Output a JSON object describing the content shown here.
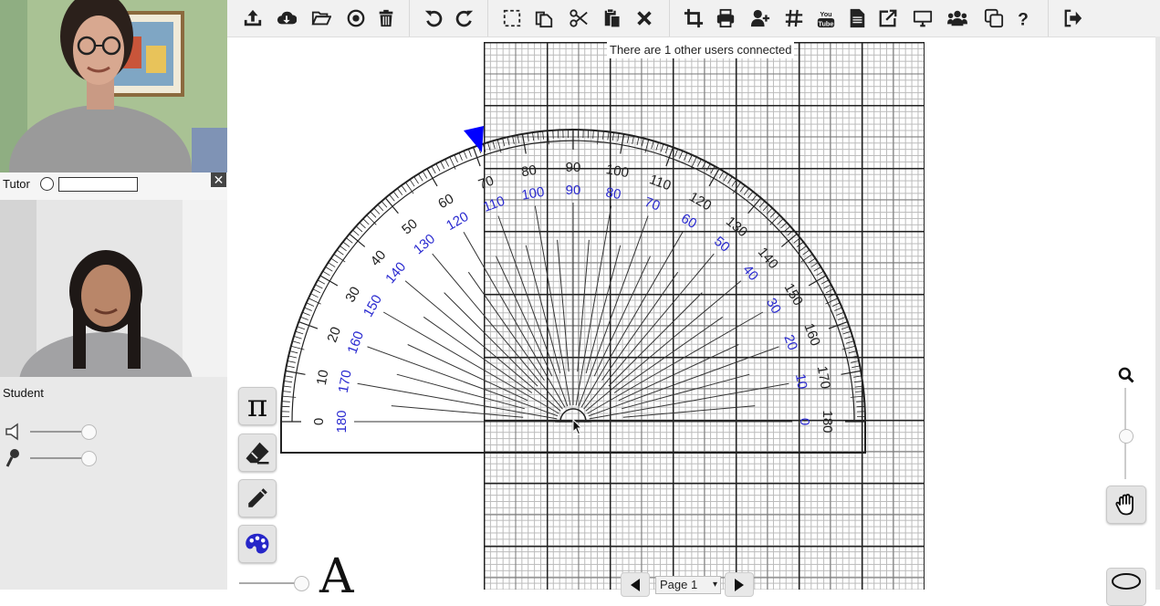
{
  "session": {
    "connection_status": "There are 1 other users connected"
  },
  "videos": {
    "tutor_label": "Tutor",
    "tutor_input_value": "",
    "close_symbol": "✕",
    "student_label": "Student",
    "speaker_volume": 0.95,
    "mic_volume": 0.95
  },
  "toolbar": {
    "buttons": [
      {
        "icon": "upload-icon"
      },
      {
        "icon": "download-cloud-icon"
      },
      {
        "icon": "open-folder-icon"
      },
      {
        "icon": "record-icon"
      },
      {
        "icon": "trash-icon"
      },
      {
        "icon": "undo-icon"
      },
      {
        "icon": "redo-icon"
      },
      {
        "icon": "select-area-icon"
      },
      {
        "icon": "copy-icon"
      },
      {
        "icon": "cut-icon"
      },
      {
        "icon": "paste-icon"
      },
      {
        "icon": "delete-x-icon"
      },
      {
        "icon": "crop-icon"
      },
      {
        "icon": "print-icon"
      },
      {
        "icon": "add-user-icon"
      },
      {
        "icon": "grid-icon"
      },
      {
        "icon": "youtube-icon"
      },
      {
        "icon": "document-icon"
      },
      {
        "icon": "external-link-icon"
      },
      {
        "icon": "screen-share-icon"
      },
      {
        "icon": "users-icon"
      },
      {
        "icon": "duplicate-icon"
      },
      {
        "icon": "help-icon"
      },
      {
        "icon": "logout-icon"
      }
    ]
  },
  "protractor": {
    "outer_scale": [
      "0",
      "10",
      "20",
      "30",
      "40",
      "50",
      "60",
      "70",
      "80",
      "90",
      "100",
      "110",
      "120",
      "130",
      "140",
      "150",
      "160",
      "170",
      "180"
    ],
    "inner_scale": [
      "180",
      "170",
      "160",
      "150",
      "140",
      "130",
      "120",
      "110",
      "100",
      "90",
      "80",
      "70",
      "60",
      "50",
      "40",
      "30",
      "20",
      "10",
      "0"
    ],
    "outer_color": "#222222",
    "inner_color": "#2a2ad0",
    "marker_color": "#0000ff"
  },
  "tools": {
    "pi_symbol": "π",
    "text_size_label": "A"
  },
  "navigation": {
    "page_label": "Page 1",
    "caret": "▾"
  },
  "zoom": {
    "level": 0.5
  }
}
